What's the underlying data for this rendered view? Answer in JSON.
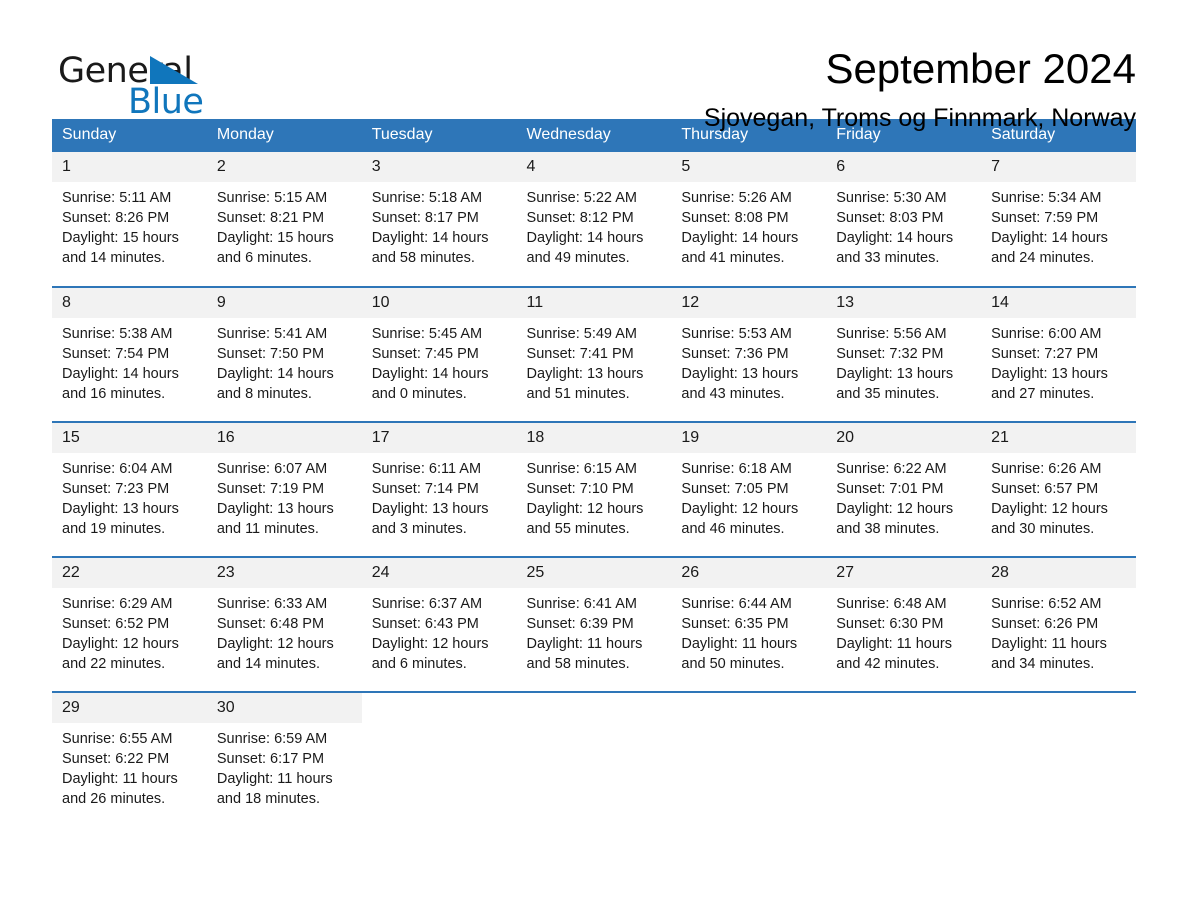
{
  "logo": {
    "word_one": "General",
    "word_two": "Blue",
    "mark": "triangle-logo-icon",
    "blue": "#1076bc"
  },
  "header": {
    "month_title": "September 2024",
    "location": "Sjovegan, Troms og Finnmark, Norway"
  },
  "theme": {
    "header_blue": "#2e76b8",
    "daynum_band": "#f2f2f2",
    "text": "#1a1a1a"
  },
  "calendar": {
    "weekdays": [
      "Sunday",
      "Monday",
      "Tuesday",
      "Wednesday",
      "Thursday",
      "Friday",
      "Saturday"
    ],
    "weeks": [
      [
        {
          "day": "1",
          "sunrise": "Sunrise: 5:11 AM",
          "sunset": "Sunset: 8:26 PM",
          "daylight_a": "Daylight: 15 hours",
          "daylight_b": "and 14 minutes."
        },
        {
          "day": "2",
          "sunrise": "Sunrise: 5:15 AM",
          "sunset": "Sunset: 8:21 PM",
          "daylight_a": "Daylight: 15 hours",
          "daylight_b": "and 6 minutes."
        },
        {
          "day": "3",
          "sunrise": "Sunrise: 5:18 AM",
          "sunset": "Sunset: 8:17 PM",
          "daylight_a": "Daylight: 14 hours",
          "daylight_b": "and 58 minutes."
        },
        {
          "day": "4",
          "sunrise": "Sunrise: 5:22 AM",
          "sunset": "Sunset: 8:12 PM",
          "daylight_a": "Daylight: 14 hours",
          "daylight_b": "and 49 minutes."
        },
        {
          "day": "5",
          "sunrise": "Sunrise: 5:26 AM",
          "sunset": "Sunset: 8:08 PM",
          "daylight_a": "Daylight: 14 hours",
          "daylight_b": "and 41 minutes."
        },
        {
          "day": "6",
          "sunrise": "Sunrise: 5:30 AM",
          "sunset": "Sunset: 8:03 PM",
          "daylight_a": "Daylight: 14 hours",
          "daylight_b": "and 33 minutes."
        },
        {
          "day": "7",
          "sunrise": "Sunrise: 5:34 AM",
          "sunset": "Sunset: 7:59 PM",
          "daylight_a": "Daylight: 14 hours",
          "daylight_b": "and 24 minutes."
        }
      ],
      [
        {
          "day": "8",
          "sunrise": "Sunrise: 5:38 AM",
          "sunset": "Sunset: 7:54 PM",
          "daylight_a": "Daylight: 14 hours",
          "daylight_b": "and 16 minutes."
        },
        {
          "day": "9",
          "sunrise": "Sunrise: 5:41 AM",
          "sunset": "Sunset: 7:50 PM",
          "daylight_a": "Daylight: 14 hours",
          "daylight_b": "and 8 minutes."
        },
        {
          "day": "10",
          "sunrise": "Sunrise: 5:45 AM",
          "sunset": "Sunset: 7:45 PM",
          "daylight_a": "Daylight: 14 hours",
          "daylight_b": "and 0 minutes."
        },
        {
          "day": "11",
          "sunrise": "Sunrise: 5:49 AM",
          "sunset": "Sunset: 7:41 PM",
          "daylight_a": "Daylight: 13 hours",
          "daylight_b": "and 51 minutes."
        },
        {
          "day": "12",
          "sunrise": "Sunrise: 5:53 AM",
          "sunset": "Sunset: 7:36 PM",
          "daylight_a": "Daylight: 13 hours",
          "daylight_b": "and 43 minutes."
        },
        {
          "day": "13",
          "sunrise": "Sunrise: 5:56 AM",
          "sunset": "Sunset: 7:32 PM",
          "daylight_a": "Daylight: 13 hours",
          "daylight_b": "and 35 minutes."
        },
        {
          "day": "14",
          "sunrise": "Sunrise: 6:00 AM",
          "sunset": "Sunset: 7:27 PM",
          "daylight_a": "Daylight: 13 hours",
          "daylight_b": "and 27 minutes."
        }
      ],
      [
        {
          "day": "15",
          "sunrise": "Sunrise: 6:04 AM",
          "sunset": "Sunset: 7:23 PM",
          "daylight_a": "Daylight: 13 hours",
          "daylight_b": "and 19 minutes."
        },
        {
          "day": "16",
          "sunrise": "Sunrise: 6:07 AM",
          "sunset": "Sunset: 7:19 PM",
          "daylight_a": "Daylight: 13 hours",
          "daylight_b": "and 11 minutes."
        },
        {
          "day": "17",
          "sunrise": "Sunrise: 6:11 AM",
          "sunset": "Sunset: 7:14 PM",
          "daylight_a": "Daylight: 13 hours",
          "daylight_b": "and 3 minutes."
        },
        {
          "day": "18",
          "sunrise": "Sunrise: 6:15 AM",
          "sunset": "Sunset: 7:10 PM",
          "daylight_a": "Daylight: 12 hours",
          "daylight_b": "and 55 minutes."
        },
        {
          "day": "19",
          "sunrise": "Sunrise: 6:18 AM",
          "sunset": "Sunset: 7:05 PM",
          "daylight_a": "Daylight: 12 hours",
          "daylight_b": "and 46 minutes."
        },
        {
          "day": "20",
          "sunrise": "Sunrise: 6:22 AM",
          "sunset": "Sunset: 7:01 PM",
          "daylight_a": "Daylight: 12 hours",
          "daylight_b": "and 38 minutes."
        },
        {
          "day": "21",
          "sunrise": "Sunrise: 6:26 AM",
          "sunset": "Sunset: 6:57 PM",
          "daylight_a": "Daylight: 12 hours",
          "daylight_b": "and 30 minutes."
        }
      ],
      [
        {
          "day": "22",
          "sunrise": "Sunrise: 6:29 AM",
          "sunset": "Sunset: 6:52 PM",
          "daylight_a": "Daylight: 12 hours",
          "daylight_b": "and 22 minutes."
        },
        {
          "day": "23",
          "sunrise": "Sunrise: 6:33 AM",
          "sunset": "Sunset: 6:48 PM",
          "daylight_a": "Daylight: 12 hours",
          "daylight_b": "and 14 minutes."
        },
        {
          "day": "24",
          "sunrise": "Sunrise: 6:37 AM",
          "sunset": "Sunset: 6:43 PM",
          "daylight_a": "Daylight: 12 hours",
          "daylight_b": "and 6 minutes."
        },
        {
          "day": "25",
          "sunrise": "Sunrise: 6:41 AM",
          "sunset": "Sunset: 6:39 PM",
          "daylight_a": "Daylight: 11 hours",
          "daylight_b": "and 58 minutes."
        },
        {
          "day": "26",
          "sunrise": "Sunrise: 6:44 AM",
          "sunset": "Sunset: 6:35 PM",
          "daylight_a": "Daylight: 11 hours",
          "daylight_b": "and 50 minutes."
        },
        {
          "day": "27",
          "sunrise": "Sunrise: 6:48 AM",
          "sunset": "Sunset: 6:30 PM",
          "daylight_a": "Daylight: 11 hours",
          "daylight_b": "and 42 minutes."
        },
        {
          "day": "28",
          "sunrise": "Sunrise: 6:52 AM",
          "sunset": "Sunset: 6:26 PM",
          "daylight_a": "Daylight: 11 hours",
          "daylight_b": "and 34 minutes."
        }
      ],
      [
        {
          "day": "29",
          "sunrise": "Sunrise: 6:55 AM",
          "sunset": "Sunset: 6:22 PM",
          "daylight_a": "Daylight: 11 hours",
          "daylight_b": "and 26 minutes."
        },
        {
          "day": "30",
          "sunrise": "Sunrise: 6:59 AM",
          "sunset": "Sunset: 6:17 PM",
          "daylight_a": "Daylight: 11 hours",
          "daylight_b": "and 18 minutes."
        },
        {
          "day": "",
          "sunrise": "",
          "sunset": "",
          "daylight_a": "",
          "daylight_b": ""
        },
        {
          "day": "",
          "sunrise": "",
          "sunset": "",
          "daylight_a": "",
          "daylight_b": ""
        },
        {
          "day": "",
          "sunrise": "",
          "sunset": "",
          "daylight_a": "",
          "daylight_b": ""
        },
        {
          "day": "",
          "sunrise": "",
          "sunset": "",
          "daylight_a": "",
          "daylight_b": ""
        },
        {
          "day": "",
          "sunrise": "",
          "sunset": "",
          "daylight_a": "",
          "daylight_b": ""
        }
      ]
    ]
  }
}
